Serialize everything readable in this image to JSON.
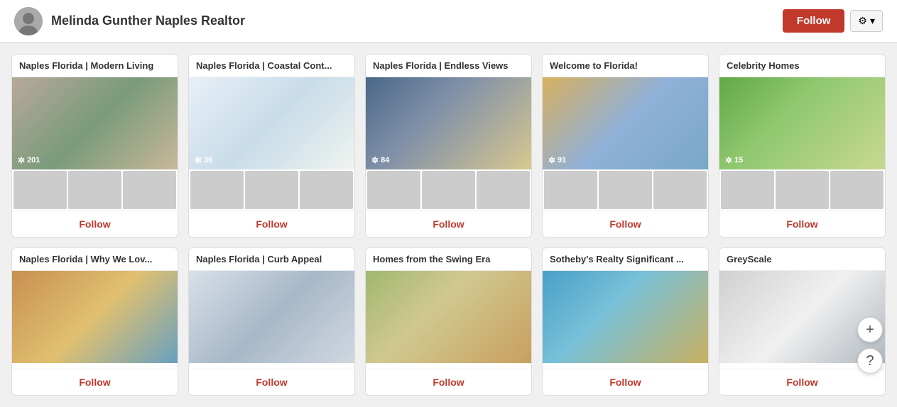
{
  "header": {
    "user_name": "Melinda Gunther Naples Realtor",
    "follow_button_label": "Follow",
    "settings_label": "⚙"
  },
  "boards": [
    {
      "id": "modern-living",
      "title": "Naples Florida | Modern Living",
      "pin_count": "201",
      "main_img_class": "img-modern",
      "thumbs": [
        "thumb-1",
        "thumb-2",
        "thumb-3"
      ],
      "follow_label": "Follow"
    },
    {
      "id": "coastal-cont",
      "title": "Naples Florida | Coastal Cont...",
      "pin_count": "36",
      "main_img_class": "img-coastal",
      "thumbs": [
        "thumb-4",
        "thumb-5",
        "thumb-6"
      ],
      "follow_label": "Follow"
    },
    {
      "id": "endless-views",
      "title": "Naples Florida | Endless Views",
      "pin_count": "84",
      "main_img_class": "img-endless",
      "thumbs": [
        "thumb-7",
        "thumb-8",
        "thumb-9"
      ],
      "follow_label": "Follow"
    },
    {
      "id": "welcome-florida",
      "title": "Welcome to Florida!",
      "pin_count": "91",
      "main_img_class": "img-welcome",
      "thumbs": [
        "thumb-3",
        "thumb-5",
        "thumb-1"
      ],
      "follow_label": "Follow"
    },
    {
      "id": "celebrity-homes",
      "title": "Celebrity Homes",
      "pin_count": "15",
      "main_img_class": "img-celebrity",
      "thumbs": [
        "thumb-2",
        "thumb-6",
        "thumb-9"
      ],
      "follow_label": "Follow"
    },
    {
      "id": "why-we-love",
      "title": "Naples Florida | Why We Lov...",
      "pin_count": "",
      "main_img_class": "img-whylove",
      "thumbs": [],
      "follow_label": "Follow"
    },
    {
      "id": "curb-appeal",
      "title": "Naples Florida | Curb Appeal",
      "pin_count": "",
      "main_img_class": "img-curb",
      "thumbs": [],
      "follow_label": "Follow"
    },
    {
      "id": "swing-era",
      "title": "Homes from the Swing Era",
      "pin_count": "",
      "main_img_class": "img-swing",
      "thumbs": [],
      "follow_label": "Follow"
    },
    {
      "id": "sotheby",
      "title": "Sotheby's Realty Significant ...",
      "pin_count": "",
      "main_img_class": "img-sotheby",
      "thumbs": [],
      "follow_label": "Follow"
    },
    {
      "id": "greyscale",
      "title": "GreyScale",
      "pin_count": "",
      "main_img_class": "img-grey",
      "thumbs": [],
      "follow_label": "Follow"
    }
  ],
  "float": {
    "plus_label": "+",
    "question_label": "?"
  }
}
